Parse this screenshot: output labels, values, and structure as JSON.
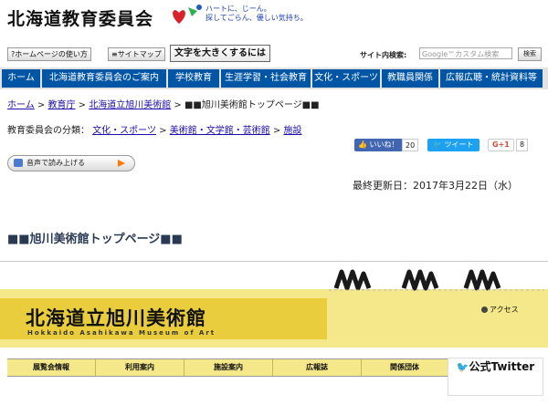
{
  "header": {
    "site_title": "北海道教育委員会",
    "tagline_line1": "ハートに、じーん。",
    "tagline_line2": "探してごらん、優しい気持ち。"
  },
  "utility": {
    "howto": "ホームページの使い方",
    "sitemap": "サイトマップ",
    "text_size": "文字を大きくするには",
    "search_label": "サイト内検索:",
    "search_placeholder": "Google™カスタム検索",
    "search_button": "検索"
  },
  "gnav": [
    "ホーム",
    "北海道教育委員会のご案内",
    "学校教育",
    "生涯学習・社会教育",
    "文化・スポーツ",
    "教職員関係",
    "広報広聴・統計資料等"
  ],
  "breadcrumb": {
    "home": "ホーム",
    "sep": " > ",
    "level1": "教育庁",
    "level2": "北海道立旭川美術館",
    "current": "■■旭川美術館トップページ■■"
  },
  "classification": {
    "label": "教育委員会の分類：",
    "c1": "文化・スポーツ",
    "c2": "美術館・文学館・芸術館",
    "c3": "施設"
  },
  "social": {
    "like_label": "いいね！",
    "like_count": "20",
    "tweet_label": "ツイート",
    "gplus_label": "G+1",
    "gplus_count": "8"
  },
  "readaloud_label": "音声で読み上げる",
  "updated": "最終更新日：2017年3月22日（水）",
  "page_heading": "■■旭川美術館トップページ■■",
  "banner": {
    "museum_name": "北海道立旭川美術館",
    "museum_en": "Hokkaido Asahikawa Museum of Art",
    "access": "アクセス"
  },
  "menu": [
    "展覧会情報",
    "利用案内",
    "施設案内",
    "広報誌",
    "関係団体"
  ],
  "twitter_label": "公式Twitter",
  "colors": {
    "nav_blue": "#0055a5",
    "banner_yellow": "#f5e88a",
    "banner_yellow_dark": "#e9cd3c"
  }
}
